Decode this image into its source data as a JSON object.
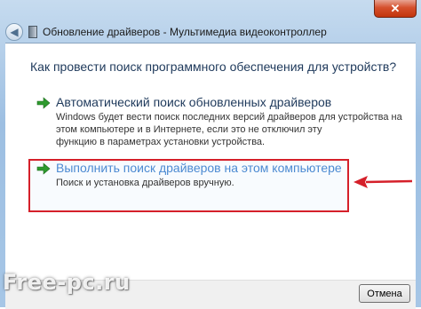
{
  "window": {
    "title": "Обновление драйверов - Мультимедиа видеоконтроллер",
    "close_label": "✕",
    "back_icon": "back-arrow-icon"
  },
  "main": {
    "heading": "Как провести поиск программного обеспечения для устройств?",
    "options": [
      {
        "title": "Автоматический поиск обновленных драйверов",
        "description_lines": [
          "Windows будет вести поиск последних версий драйверов для устройства на",
          "этом компьютере и в Интернете, если это не отключил эту",
          "функцию в параметрах установки устройства."
        ],
        "icon": "green-arrow-icon"
      },
      {
        "title": "Выполнить поиск драйверов на этом компьютере",
        "description_lines": [
          "Поиск и установка драйверов вручную."
        ],
        "icon": "green-arrow-icon"
      }
    ]
  },
  "footer": {
    "cancel_label": "Отмена"
  },
  "watermark": "Free-pc.ru",
  "colors": {
    "heading": "#1e395b",
    "link_hover": "#4c8ad2",
    "highlight": "#d5202a",
    "arrow_green": "#2e9a2e"
  }
}
